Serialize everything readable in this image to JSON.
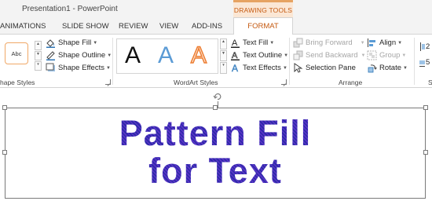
{
  "window": {
    "title": "Presentation1 - PowerPoint",
    "contextual_header": "DRAWING TOOLS"
  },
  "tabs": [
    {
      "label": "ANIMATIONS"
    },
    {
      "label": "SLIDE SHOW"
    },
    {
      "label": "REVIEW"
    },
    {
      "label": "VIEW"
    },
    {
      "label": "ADD-INS"
    },
    {
      "label": "FORMAT",
      "active": true
    }
  ],
  "ribbon": {
    "shape_styles": {
      "thumb_label": "Abc",
      "shape_fill": "Shape Fill",
      "shape_outline": "Shape Outline",
      "shape_effects": "Shape Effects",
      "group_label": "hape Styles"
    },
    "wordart_styles": {
      "gallery": [
        {
          "letter": "A",
          "style": "black"
        },
        {
          "letter": "A",
          "style": "blue"
        },
        {
          "letter": "A",
          "style": "orange-outline"
        }
      ],
      "text_fill": "Text Fill",
      "text_outline": "Text Outline",
      "text_effects": "Text Effects",
      "group_label": "WordArt Styles"
    },
    "arrange": {
      "bring_forward": "Bring Forward",
      "send_backward": "Send Backward",
      "selection_pane": "Selection Pane",
      "align": "Align",
      "group": "Group",
      "rotate": "Rotate",
      "group_label": "Arrange"
    },
    "size": {
      "height_value": "2",
      "width_value": "5"
    }
  },
  "slide": {
    "text_line1": "Pattern Fill",
    "text_line2": "for Text"
  },
  "colors": {
    "accent": "#c55a11",
    "contextual_bg": "#fbe7d5",
    "pattern_fg": "#5a32c6",
    "pattern_bg": "#2b2ba8"
  }
}
